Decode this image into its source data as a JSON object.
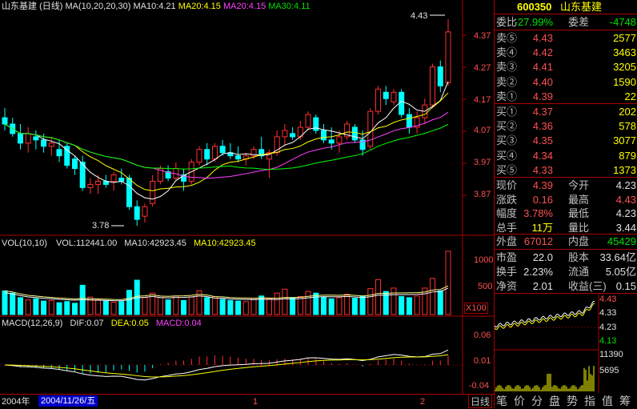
{
  "header": {
    "stock_name": "山东基建",
    "period": "(日线)",
    "ma_label": "MA(10,20,20,30)",
    "ma10": "MA10:4.21",
    "ma20a": "MA20:4.15",
    "ma20b": "MA20:4.15",
    "ma30": "MA30:4.11"
  },
  "price_axis": [
    "4.37",
    "4.27",
    "4.17",
    "4.07",
    "3.97",
    "3.87"
  ],
  "price_high_marker": "4.43",
  "price_low_marker": "3.78",
  "volume": {
    "header": "VOL(10,10)",
    "vol": "VOL:112441.00",
    "ma10a": "MA10:42923.45",
    "ma10b": "MA10:42923.45",
    "axis": [
      "1000",
      "500"
    ],
    "unit": "X100"
  },
  "macd": {
    "header": "MACD(12,26,9)",
    "dif": "DIF:0.07",
    "dea": "DEA:0.05",
    "macd": "MACD:0.04",
    "axis": [
      "0.06",
      "0.01",
      "-0.04"
    ]
  },
  "date_bar": {
    "year": "2004年",
    "date": "2004/11/26/五",
    "marks": [
      "1",
      "2"
    ]
  },
  "quote": {
    "code": "600350",
    "name": "山东基建",
    "weibi_label": "委比",
    "weibi": "-27.99%",
    "weicha_label": "委差",
    "weicha": "-4748",
    "sells": [
      {
        "label": "卖⑤",
        "price": "4.43",
        "vol": "2577"
      },
      {
        "label": "卖④",
        "price": "4.42",
        "vol": "3463"
      },
      {
        "label": "卖③",
        "price": "4.41",
        "vol": "3205"
      },
      {
        "label": "卖②",
        "price": "4.40",
        "vol": "1590"
      },
      {
        "label": "卖①",
        "price": "4.39",
        "vol": "22"
      }
    ],
    "buys": [
      {
        "label": "买①",
        "price": "4.37",
        "vol": "202"
      },
      {
        "label": "买②",
        "price": "4.36",
        "vol": "578"
      },
      {
        "label": "买③",
        "price": "4.35",
        "vol": "3077"
      },
      {
        "label": "买④",
        "price": "4.34",
        "vol": "879"
      },
      {
        "label": "买⑤",
        "price": "4.33",
        "vol": "1373"
      }
    ],
    "stats": [
      {
        "l1": "现价",
        "v1": "4.39",
        "c1": "red",
        "l2": "今开",
        "v2": "4.23",
        "c2": "wht"
      },
      {
        "l1": "涨跌",
        "v1": "0.16",
        "c1": "red",
        "l2": "最高",
        "v2": "4.43",
        "c2": "red"
      },
      {
        "l1": "幅度",
        "v1": "3.78%",
        "c1": "red",
        "l2": "最低",
        "v2": "4.23",
        "c2": "wht"
      },
      {
        "l1": "总手",
        "v1": "11万",
        "c1": "ylw",
        "l2": "量比",
        "v2": "3.44",
        "c2": "wht"
      }
    ],
    "waipan_label": "外盘",
    "waipan": "67012",
    "neipan_label": "内盘",
    "neipan": "45429",
    "fund": [
      {
        "l1": "市盈",
        "v1": "22.0",
        "l2": "股本",
        "v2": "33.64亿"
      },
      {
        "l1": "换手",
        "v1": "2.23%",
        "l2": "流通",
        "v2": "5.05亿"
      },
      {
        "l1": "净资",
        "v1": "2.01",
        "l2": "收益(三)",
        "v2": "0.15"
      }
    ],
    "mini_axis": [
      "4.43",
      "4.33",
      "4.23",
      "4.13",
      "11390",
      "5695"
    ]
  },
  "tabs": [
    "日线",
    "笔",
    "价",
    "分",
    "盘",
    "势",
    "指",
    "值",
    "筹"
  ],
  "chart_data": {
    "type": "candlestick",
    "title": "山东基建 (日线)",
    "ylim": [
      3.76,
      4.45
    ],
    "candles": [
      [
        4.12,
        4.15,
        4.08,
        4.1
      ],
      [
        4.1,
        4.12,
        4.06,
        4.07
      ],
      [
        4.07,
        4.1,
        4.02,
        4.04
      ],
      [
        4.04,
        4.09,
        4.01,
        4.07
      ],
      [
        4.06,
        4.08,
        4.02,
        4.05
      ],
      [
        4.05,
        4.07,
        4.01,
        4.03
      ],
      [
        4.03,
        4.06,
        4.0,
        4.04
      ],
      [
        4.02,
        4.05,
        3.98,
        4.0
      ],
      [
        4.03,
        4.04,
        3.96,
        3.97
      ],
      [
        3.99,
        4.0,
        3.94,
        3.96
      ],
      [
        3.98,
        4.0,
        3.89,
        3.9
      ],
      [
        3.9,
        3.93,
        3.88,
        3.91
      ],
      [
        3.91,
        3.94,
        3.88,
        3.92
      ],
      [
        3.92,
        3.94,
        3.9,
        3.91
      ],
      [
        3.92,
        3.95,
        3.89,
        3.94
      ],
      [
        3.93,
        3.96,
        3.91,
        3.92
      ],
      [
        3.93,
        3.94,
        3.83,
        3.84
      ],
      [
        3.84,
        3.86,
        3.78,
        3.8
      ],
      [
        3.81,
        3.85,
        3.79,
        3.84
      ],
      [
        3.85,
        3.94,
        3.84,
        3.92
      ],
      [
        3.92,
        3.97,
        3.91,
        3.96
      ],
      [
        3.95,
        3.97,
        3.92,
        3.93
      ],
      [
        3.93,
        3.98,
        3.92,
        3.96
      ],
      [
        3.94,
        3.96,
        3.89,
        3.92
      ],
      [
        3.92,
        3.99,
        3.91,
        3.98
      ],
      [
        3.98,
        4.03,
        3.97,
        4.02
      ],
      [
        4.02,
        4.04,
        3.97,
        3.99
      ],
      [
        3.99,
        4.04,
        3.98,
        4.03
      ],
      [
        4.03,
        4.05,
        4.0,
        4.01
      ],
      [
        4.01,
        4.04,
        3.99,
        4.0
      ],
      [
        4.0,
        4.03,
        3.98,
        3.99
      ],
      [
        3.99,
        4.01,
        3.97,
        4.0
      ],
      [
        4.0,
        4.03,
        3.99,
        4.02
      ],
      [
        4.02,
        4.06,
        3.99,
        4.0
      ],
      [
        3.99,
        4.02,
        3.93,
        4.01
      ],
      [
        4.01,
        4.08,
        4.0,
        4.06
      ],
      [
        4.06,
        4.1,
        4.03,
        4.08
      ],
      [
        4.07,
        4.09,
        4.05,
        4.06
      ],
      [
        4.06,
        4.11,
        4.05,
        4.09
      ],
      [
        4.09,
        4.14,
        4.08,
        4.13
      ],
      [
        4.12,
        4.13,
        4.07,
        4.08
      ],
      [
        4.08,
        4.1,
        4.04,
        4.05
      ],
      [
        4.05,
        4.09,
        4.02,
        4.04
      ],
      [
        4.04,
        4.08,
        4.01,
        4.06
      ],
      [
        4.06,
        4.11,
        4.05,
        4.1
      ],
      [
        4.09,
        4.1,
        4.04,
        4.05
      ],
      [
        4.05,
        4.08,
        4.0,
        4.02
      ],
      [
        4.03,
        4.15,
        4.02,
        4.14
      ],
      [
        4.14,
        4.22,
        4.13,
        4.21
      ],
      [
        4.2,
        4.22,
        4.16,
        4.18
      ],
      [
        4.17,
        4.21,
        4.16,
        4.2
      ],
      [
        4.2,
        4.21,
        4.12,
        4.13
      ],
      [
        4.13,
        4.15,
        4.07,
        4.09
      ],
      [
        4.09,
        4.14,
        4.07,
        4.12
      ],
      [
        4.12,
        4.18,
        4.1,
        4.16
      ],
      [
        4.16,
        4.29,
        4.15,
        4.28
      ],
      [
        4.28,
        4.3,
        4.2,
        4.22
      ],
      [
        4.23,
        4.43,
        4.22,
        4.39
      ]
    ],
    "volume": [
      420,
      380,
      300,
      260,
      280,
      240,
      250,
      210,
      230,
      200,
      520,
      310,
      260,
      240,
      220,
      230,
      430,
      610,
      300,
      380,
      300,
      260,
      330,
      250,
      310,
      420,
      300,
      320,
      270,
      250,
      240,
      230,
      290,
      330,
      280,
      380,
      450,
      300,
      320,
      410,
      380,
      310,
      280,
      300,
      360,
      290,
      330,
      460,
      620,
      410,
      470,
      320,
      300,
      330,
      470,
      640,
      420,
      1124
    ]
  }
}
